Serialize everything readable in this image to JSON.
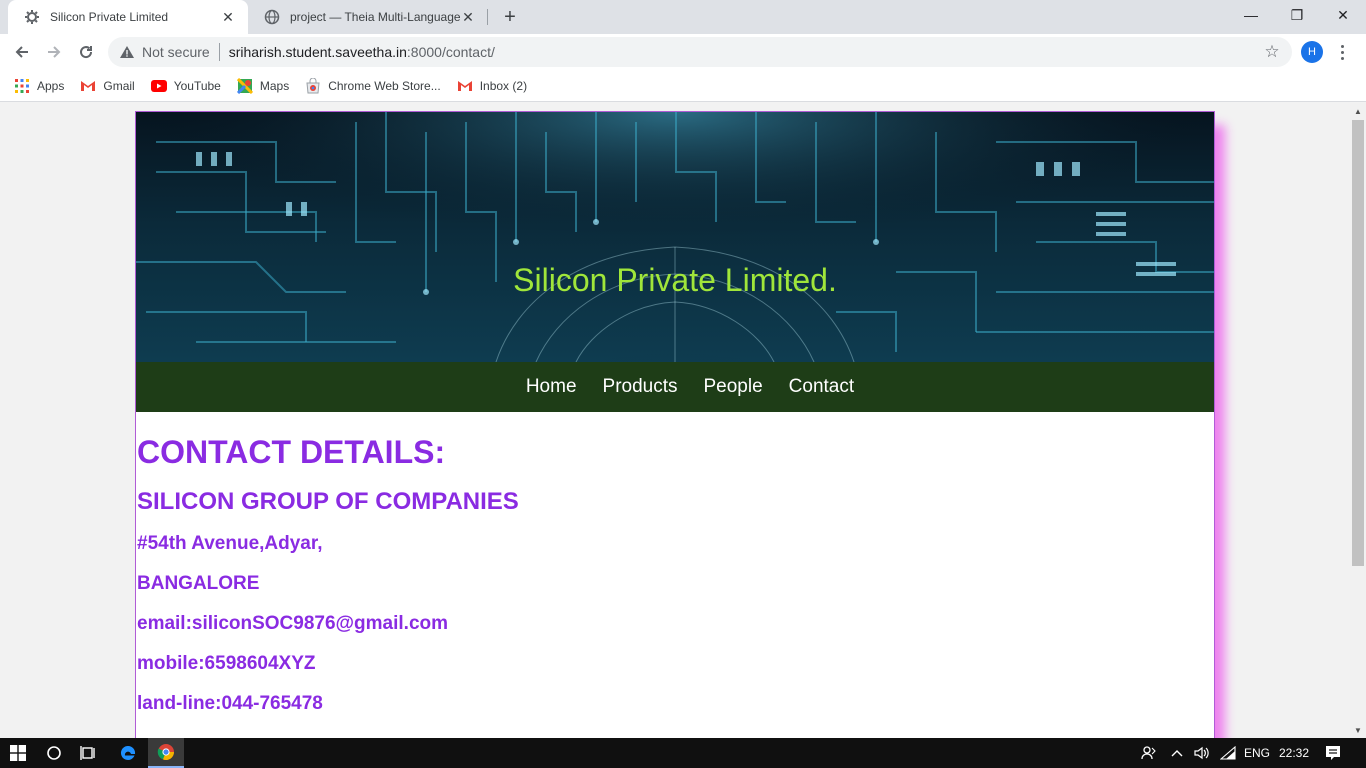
{
  "browser": {
    "tabs": [
      {
        "title": "Silicon Private Limited",
        "active": true
      },
      {
        "title": "project — Theia Multi-Language",
        "active": false
      }
    ],
    "new_tab_symbol": "+",
    "close_symbol": "✕",
    "window_controls": {
      "minimize": "—",
      "maximize": "❐",
      "close": "✕"
    },
    "omnibox": {
      "security_label": "Not secure",
      "url_host": "sriharish.student.saveetha.in",
      "url_path": ":8000/contact/"
    },
    "profile_initial": "H",
    "bookmarks": [
      {
        "label": "Apps",
        "icon": "apps-grid-icon"
      },
      {
        "label": "Gmail",
        "icon": "gmail-icon"
      },
      {
        "label": "YouTube",
        "icon": "youtube-icon"
      },
      {
        "label": "Maps",
        "icon": "maps-icon"
      },
      {
        "label": "Chrome Web Store...",
        "icon": "webstore-icon"
      },
      {
        "label": "Inbox (2)",
        "icon": "gmail-icon"
      }
    ]
  },
  "site": {
    "banner_title": "Silicon Private Limited.",
    "nav": [
      "Home",
      "Products",
      "People",
      "Contact"
    ],
    "heading": "CONTACT DETAILS:",
    "company": "SILICON GROUP OF COMPANIES",
    "address_line": "#54th Avenue,Adyar,",
    "city": "BANGALORE",
    "email": "email:siliconSOC9876@gmail.com",
    "mobile": "mobile:6598604XYZ",
    "landline": "land-line:044-765478"
  },
  "taskbar": {
    "language": "ENG",
    "time": "22:32"
  },
  "colors": {
    "accent_text": "#8a2be2",
    "nav_bg": "#1e3d17",
    "banner_title": "#a0e63a",
    "shadow": "#ee82ee"
  }
}
